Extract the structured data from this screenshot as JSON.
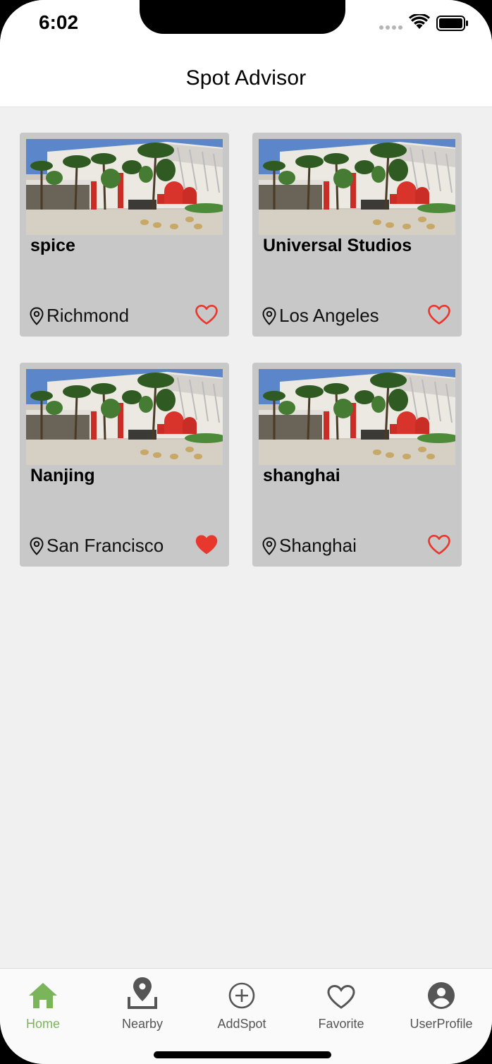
{
  "status_bar": {
    "time": "6:02"
  },
  "header": {
    "title": "Spot Advisor"
  },
  "spots": [
    {
      "name": "spice",
      "location": "Richmond",
      "favorited": false
    },
    {
      "name": "Universal Studios",
      "location": "Los Angeles",
      "favorited": false
    },
    {
      "name": "Nanjing",
      "location": "San Francisco",
      "favorited": true
    },
    {
      "name": "shanghai",
      "location": "Shanghai",
      "favorited": false
    }
  ],
  "tabs": [
    {
      "label": "Home",
      "icon": "home-icon",
      "active": true
    },
    {
      "label": "Nearby",
      "icon": "map-pin-icon",
      "active": false
    },
    {
      "label": "AddSpot",
      "icon": "add-circle-icon",
      "active": false
    },
    {
      "label": "Favorite",
      "icon": "heart-outline-icon",
      "active": false
    },
    {
      "label": "UserProfile",
      "icon": "account-circle-icon",
      "active": false
    }
  ],
  "colors": {
    "accent": "#7ab55c",
    "heart": "#e8372c",
    "card_background": "#c8c8c8",
    "page_background": "#f0f0f0"
  }
}
